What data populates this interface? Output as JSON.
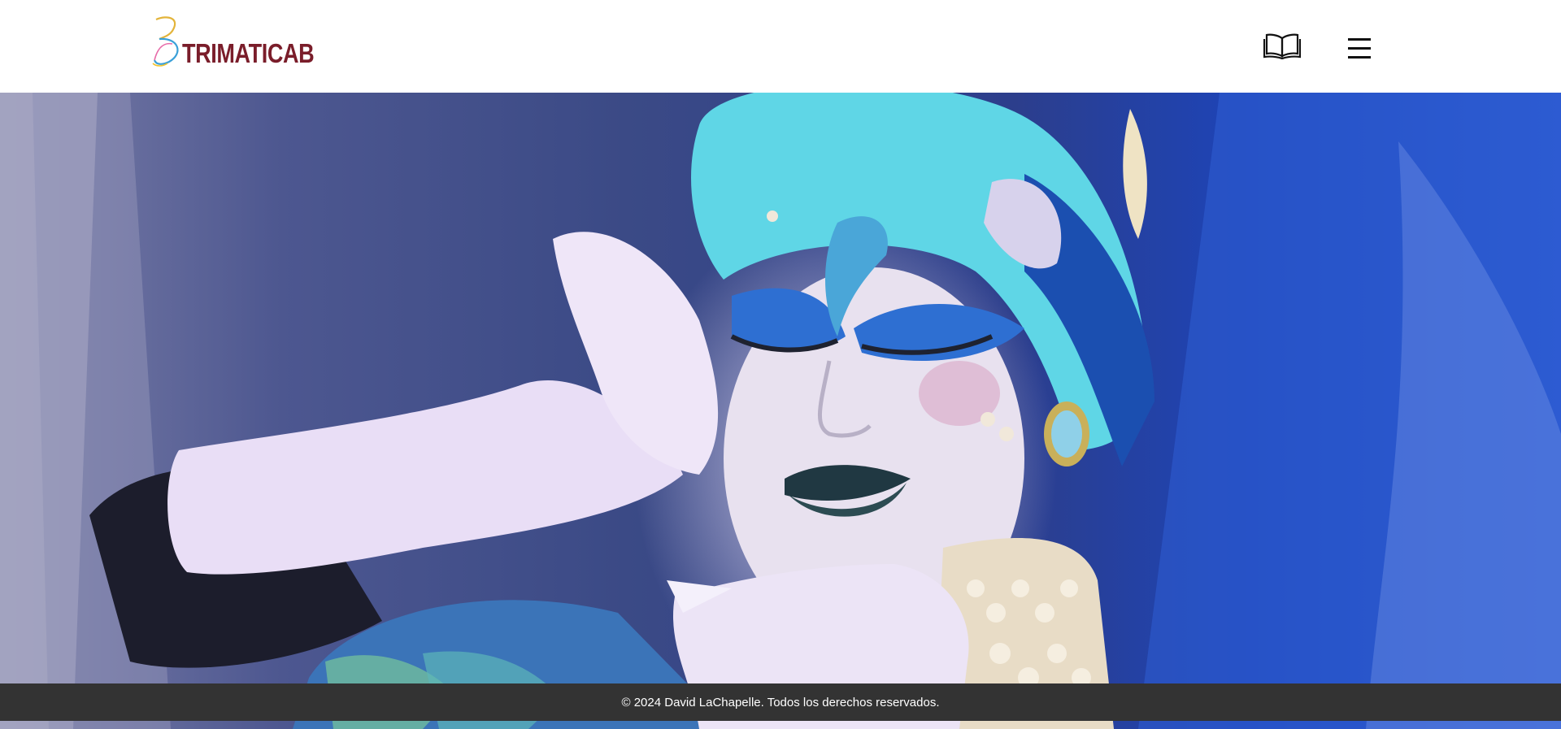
{
  "header": {
    "brand_name": "TRIMATICAB",
    "logo_icon": "stylized-3-logo-icon",
    "book_icon": "open-book-icon",
    "menu_icon": "hamburger-menu-icon"
  },
  "hero": {
    "image_subject": "artistic portrait photograph"
  },
  "footer": {
    "copyright": "© 2024 David LaChapelle. Todos los derechos reservados."
  },
  "colors": {
    "brand": "#7a1d2a",
    "footer_bg": "#333333",
    "footer_text": "#ffffff",
    "header_bg": "#ffffff"
  }
}
